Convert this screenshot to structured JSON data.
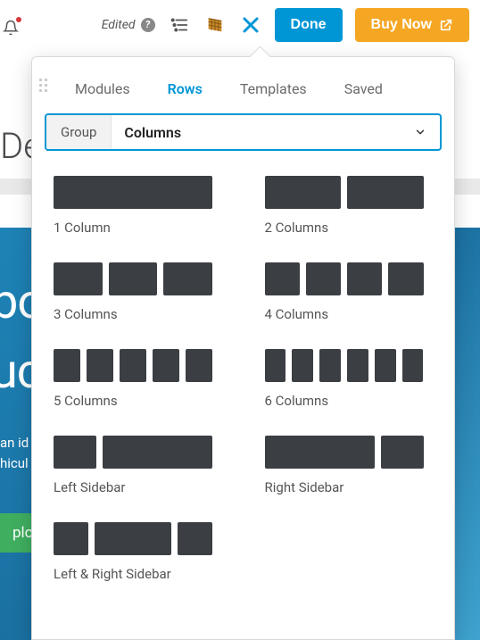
{
  "toolbar": {
    "edited_label": "Edited",
    "done_label": "Done",
    "buy_label": "Buy Now"
  },
  "background": {
    "title_fragment": "De",
    "hero_line1": "bo",
    "hero_line2": "uc",
    "hero_p1": "an id",
    "hero_p2": "hicul",
    "cta_fragment": "plore"
  },
  "panel": {
    "tabs": {
      "modules": "Modules",
      "rows": "Rows",
      "templates": "Templates",
      "saved": "Saved"
    },
    "group_label": "Group",
    "group_value": "Columns",
    "layouts": [
      {
        "name": "1 Column",
        "cols": [
          1
        ]
      },
      {
        "name": "2 Columns",
        "cols": [
          1,
          1
        ]
      },
      {
        "name": "3 Columns",
        "cols": [
          1,
          1,
          1
        ]
      },
      {
        "name": "4 Columns",
        "cols": [
          1,
          1,
          1,
          1
        ]
      },
      {
        "name": "5 Columns",
        "cols": [
          1,
          1,
          1,
          1,
          1
        ]
      },
      {
        "name": "6 Columns",
        "cols": [
          1,
          1,
          1,
          1,
          1,
          1
        ]
      },
      {
        "name": "Left Sidebar",
        "cols": [
          1,
          2.6
        ]
      },
      {
        "name": "Right Sidebar",
        "cols": [
          2.6,
          1
        ]
      },
      {
        "name": "Left & Right Sidebar",
        "cols": [
          1,
          2.2,
          1
        ]
      }
    ]
  }
}
